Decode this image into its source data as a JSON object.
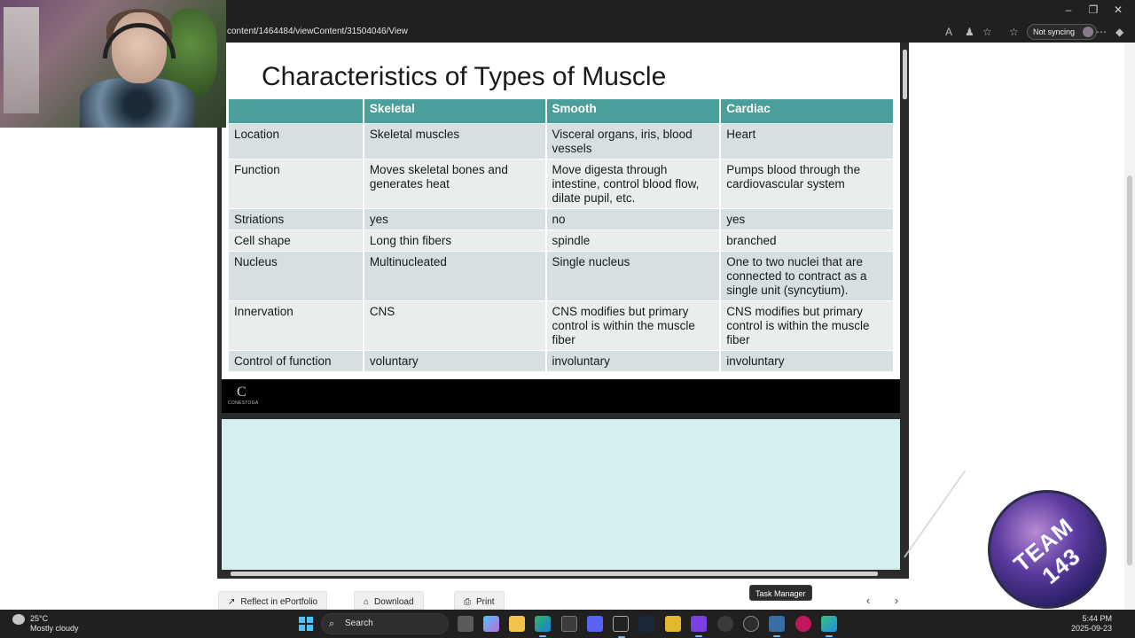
{
  "browser": {
    "url": "content/1464484/viewContent/31504046/View",
    "sync_label": "Not syncing"
  },
  "slide": {
    "title": "Characteristics of Types of Muscle",
    "headers": [
      "",
      "Skeletal",
      "Smooth",
      "Cardiac"
    ],
    "rows": [
      [
        "Location",
        "Skeletal muscles",
        "Visceral organs, iris, blood vessels",
        "Heart"
      ],
      [
        "Function",
        "Moves skeletal bones and generates heat",
        "Move digesta through intestine, control blood flow, dilate pupil, etc.",
        "Pumps blood through the cardiovascular system"
      ],
      [
        "Striations",
        "yes",
        "no",
        "yes"
      ],
      [
        "Cell shape",
        "Long thin fibers",
        "spindle",
        "branched"
      ],
      [
        "Nucleus",
        "Multinucleated",
        "Single nucleus",
        "One to two nuclei that are connected to contract as a single unit (syncytium)."
      ],
      [
        "Innervation",
        "CNS",
        "CNS modifies but primary control is within the muscle fiber",
        "CNS modifies but primary control is within the muscle fiber"
      ],
      [
        "Control of function",
        "voluntary",
        "involuntary",
        "involuntary"
      ]
    ],
    "footer_logo_mark": "C",
    "footer_logo_text": "CONESTOGA"
  },
  "actions": {
    "reflect_label": "Reflect in ePortfolio",
    "download_label": "Download",
    "print_label": "Print"
  },
  "tooltip": "Task Manager",
  "badge_text": "TEAM 143",
  "taskbar": {
    "weather_temp": "25°C",
    "weather_desc": "Mostly cloudy",
    "search_label": "Search",
    "time": "5:44 PM",
    "date": "2025-09-23"
  },
  "colors": {
    "table_header": "#4a9e9b",
    "row_odd": "#d7e0e0",
    "row_even": "#e9eded",
    "notes_bg": "#d5eeee"
  }
}
